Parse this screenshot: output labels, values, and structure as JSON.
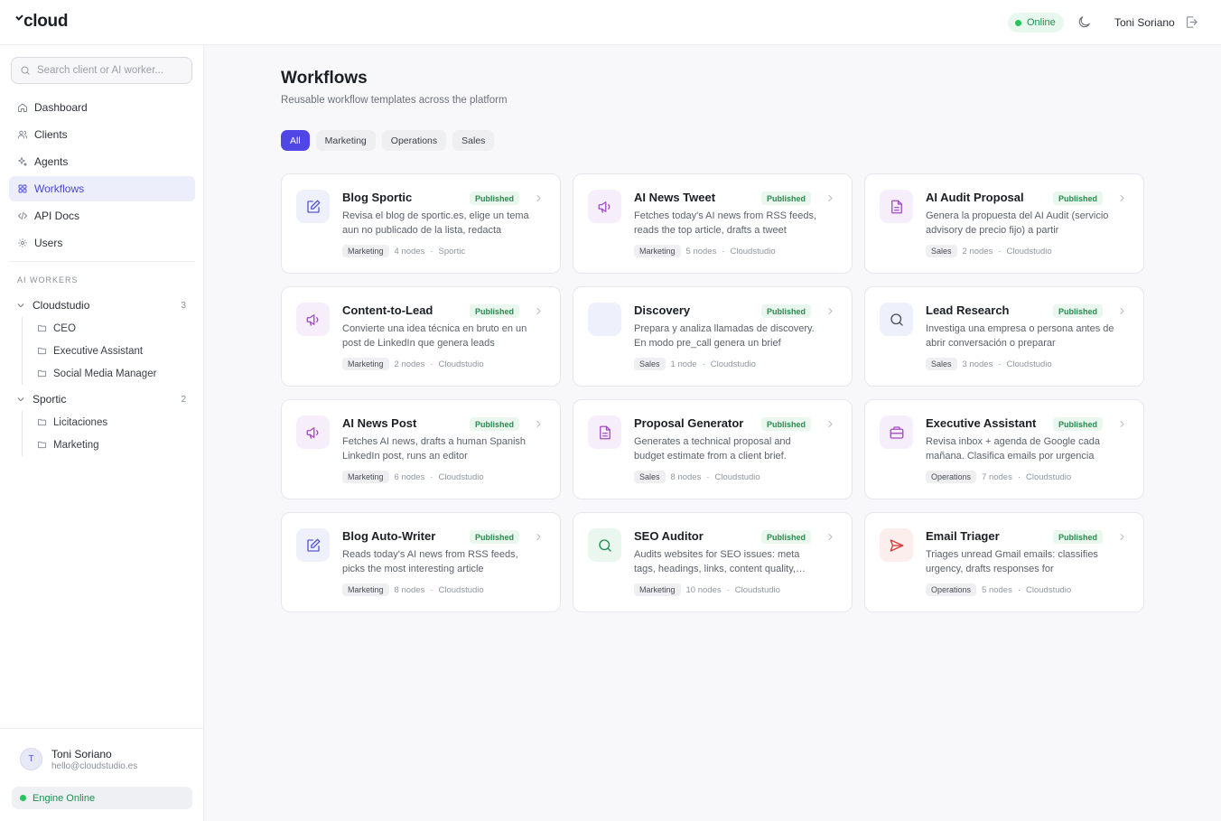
{
  "topbar": {
    "logo": "cloud",
    "status": "Online",
    "user_name": "Toni Soriano",
    "icons": {
      "theme": "moon-icon",
      "logout": "logout-icon"
    }
  },
  "sidebar": {
    "search_placeholder": "Search client or AI worker...",
    "nav": [
      {
        "label": "Dashboard",
        "icon": "home-icon"
      },
      {
        "label": "Clients",
        "icon": "users-icon"
      },
      {
        "label": "Agents",
        "icon": "sparkles-icon"
      },
      {
        "label": "Workflows",
        "icon": "grid-icon",
        "active": true
      },
      {
        "label": "API Docs",
        "icon": "code-icon"
      },
      {
        "label": "Users",
        "icon": "gear-icon"
      }
    ],
    "section_label": "AI WORKERS",
    "groups": [
      {
        "name": "Cloudstudio",
        "count": "3",
        "children": [
          "CEO",
          "Executive Assistant",
          "Social Media Manager"
        ]
      },
      {
        "name": "Sportic",
        "count": "2",
        "children": [
          "Licitaciones",
          "Marketing"
        ]
      }
    ],
    "user": {
      "initial": "T",
      "name": "Toni Soriano",
      "email": "hello@cloudstudio.es"
    },
    "engine_status": "Engine Online"
  },
  "main": {
    "title": "Workflows",
    "subtitle": "Reusable workflow templates across the platform",
    "filters": [
      "All",
      "Marketing",
      "Operations",
      "Sales"
    ],
    "active_filter": "All",
    "cards": [
      {
        "title": "Blog Sportic",
        "status": "Published",
        "desc": "Revisa el blog de sportic.es, elige un tema aun no publicado de la lista, redacta",
        "tag": "Marketing",
        "nodes": "4 nodes",
        "owner": "Sportic",
        "icon": "edit-icon"
      },
      {
        "title": "AI News Tweet",
        "status": "Published",
        "desc": "Fetches today's AI news from RSS feeds, reads the top article, drafts a tweet",
        "tag": "Marketing",
        "nodes": "5 nodes",
        "owner": "Cloudstudio",
        "icon": "megaphone-icon"
      },
      {
        "title": "AI Audit Proposal",
        "status": "Published",
        "desc": "Genera la propuesta del AI Audit (servicio advisory de precio fijo) a partir",
        "tag": "Sales",
        "nodes": "2 nodes",
        "owner": "Cloudstudio",
        "icon": "document-icon"
      },
      {
        "title": "Content-to-Lead",
        "status": "Published",
        "desc": "Convierte una idea técnica en bruto en un post de LinkedIn que genera leads",
        "tag": "Marketing",
        "nodes": "2 nodes",
        "owner": "Cloudstudio",
        "icon": "megaphone-icon"
      },
      {
        "title": "Discovery",
        "status": "Published",
        "desc": "Prepara y analiza llamadas de discovery. En modo pre_call genera un brief",
        "tag": "Sales",
        "nodes": "1 node",
        "owner": "Cloudstudio",
        "icon": "blank-icon"
      },
      {
        "title": "Lead Research",
        "status": "Published",
        "desc": "Investiga una empresa o persona antes de abrir conversación o preparar",
        "tag": "Sales",
        "nodes": "3 nodes",
        "owner": "Cloudstudio",
        "icon": "search-icon"
      },
      {
        "title": "AI News Post",
        "status": "Published",
        "desc": "Fetches AI news, drafts a human Spanish LinkedIn post, runs an editor",
        "tag": "Marketing",
        "nodes": "6 nodes",
        "owner": "Cloudstudio",
        "icon": "megaphone-icon"
      },
      {
        "title": "Proposal Generator",
        "status": "Published",
        "desc": "Generates a technical proposal and budget estimate from a client brief.",
        "tag": "Sales",
        "nodes": "8 nodes",
        "owner": "Cloudstudio",
        "icon": "document-icon"
      },
      {
        "title": "Executive Assistant",
        "status": "Published",
        "desc": "Revisa inbox + agenda de Google cada mañana. Clasifica emails por urgencia",
        "tag": "Operations",
        "nodes": "7 nodes",
        "owner": "Cloudstudio",
        "icon": "briefcase-icon"
      },
      {
        "title": "Blog Auto-Writer",
        "status": "Published",
        "desc": "Reads today's AI news from RSS feeds, picks the most interesting article",
        "tag": "Marketing",
        "nodes": "8 nodes",
        "owner": "Cloudstudio",
        "icon": "edit-icon"
      },
      {
        "title": "SEO Auditor",
        "status": "Published",
        "desc": "Audits websites for SEO issues: meta tags, headings, links, content quality, speed",
        "tag": "Marketing",
        "nodes": "10 nodes",
        "owner": "Cloudstudio",
        "icon": "search-icon"
      },
      {
        "title": "Email Triager",
        "status": "Published",
        "desc": "Triages unread Gmail emails: classifies urgency, drafts responses for",
        "tag": "Operations",
        "nodes": "5 nodes",
        "owner": "Cloudstudio",
        "icon": "send-icon"
      }
    ]
  },
  "colors": {
    "accent": "#4f46e5",
    "online": "#22c55e",
    "published_bg": "#eaf7ef",
    "published_text": "#2a8a4f"
  }
}
